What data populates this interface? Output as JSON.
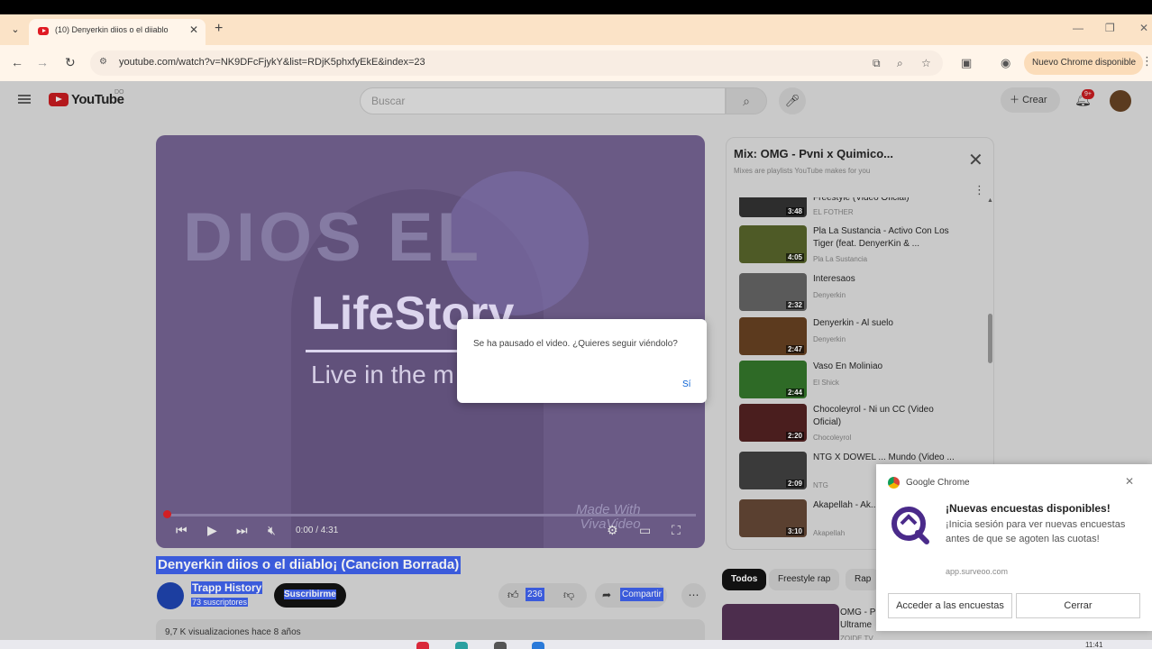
{
  "browser": {
    "tab_title": "(10) Denyerkin diios o el diiablo",
    "url": "youtube.com/watch?v=NK9DFcFjykY&list=RDjK5phxfyEkE&index=23",
    "update_label": "Nuevo Chrome disponible"
  },
  "youtube": {
    "logo": "YouTube",
    "country": "DO",
    "search_placeholder": "Buscar",
    "create_label": "Crear",
    "notif_count": "9+"
  },
  "player": {
    "overlay_big": "DIOS   EL",
    "overlay_lifestory": "LifeStory",
    "overlay_live": "Live in the m",
    "watermark": "Made With\nVivaVideo",
    "time": "0:00 / 4:31",
    "progress": 0.0
  },
  "dialog": {
    "message": "Se ha pausado el video. ¿Quieres seguir viéndolo?",
    "yes": "Sí"
  },
  "video": {
    "title": "Denyerkin diios o el diiablo¡ (Cancion Borrada)",
    "channel": "Trapp History",
    "subscribers": "73 suscriptores",
    "subscribe": "Suscribirme",
    "likes": "236",
    "share": "Compartir",
    "views": "9,7 K visualizaciones  hace 8 años"
  },
  "playlist": {
    "title": "Mix: OMG - Pvni x Quimico...",
    "subtitle": "Mixes are playlists YouTube makes for you",
    "items": [
      {
        "title": "Freestyle (Video Oficial)",
        "channel": "EL FOTHER",
        "duration": "3:48"
      },
      {
        "title": "Pla La Sustancia - Activo Con Los Tiger (feat. DenyerKin & ...",
        "channel": "Pla La Sustancia",
        "duration": "4:05"
      },
      {
        "title": "Interesaos",
        "channel": "Denyerkin",
        "duration": "2:32"
      },
      {
        "title": "Denyerkin - Al suelo",
        "channel": "Denyerkin",
        "duration": "2:47"
      },
      {
        "title": "Vaso En Moliniao",
        "channel": "El Shick",
        "duration": "2:44"
      },
      {
        "title": "Chocoleyrol - Ni un CC (Video Oficial)",
        "channel": "Chocoleyrol",
        "duration": "2:20"
      },
      {
        "title": "NTG X DOWEL ... Mundo (Video ...",
        "channel": "NTG",
        "duration": "2:09"
      },
      {
        "title": "Akapellah - Ak... NeoBeats)",
        "channel": "Akapellah",
        "duration": "3:10"
      }
    ]
  },
  "chips": [
    "Todos",
    "Freestyle rap",
    "Rap"
  ],
  "recommendation": {
    "title": "OMG - P...\nUltrame...",
    "channel": "ZOIDE TV"
  },
  "notification": {
    "app": "Google Chrome",
    "title": "¡Nuevas encuestas disponibles!",
    "body": "¡Inicia sesión para ver nuevas encuestas antes de que se agoten las cuotas!",
    "domain": "app.surveoo.com",
    "primary": "Acceder a las encuestas",
    "secondary": "Cerrar"
  },
  "taskbar": {
    "time": "11:41"
  },
  "colors": {
    "accent_red": "#d21f24",
    "selection_blue": "#3b5bdb",
    "tab_bar": "#fbe3c7"
  }
}
